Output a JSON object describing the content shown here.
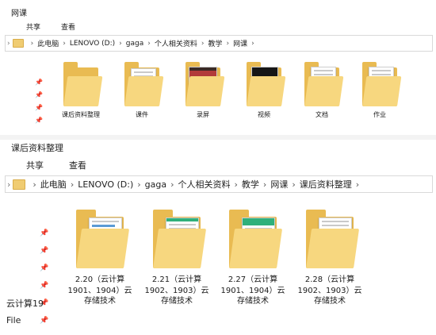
{
  "window1": {
    "title": "网课",
    "ribbon": [
      "共享",
      "查看"
    ],
    "breadcrumb": [
      "此电脑",
      "LENOVO (D:)",
      "gaga",
      "个人相关资料",
      "教学",
      "网课"
    ],
    "folders": [
      {
        "name": "课后资料整理",
        "preview": "plain"
      },
      {
        "name": "课件",
        "preview": "doc"
      },
      {
        "name": "录屏",
        "preview": "photo"
      },
      {
        "name": "视频",
        "preview": "video"
      },
      {
        "name": "文档",
        "preview": "doc"
      },
      {
        "name": "作业",
        "preview": "doc"
      }
    ]
  },
  "window2": {
    "title": "课后资料整理",
    "ribbon": [
      "共享",
      "查看"
    ],
    "breadcrumb": [
      "此电脑",
      "LENOVO (D:)",
      "gaga",
      "个人相关资料",
      "教学",
      "网课",
      "课后资料整理"
    ],
    "folders": [
      {
        "lines": [
          "2.20（云计算",
          "1901、1904）云",
          "存储技术"
        ]
      },
      {
        "lines": [
          "2.21（云计算",
          "1902、1903）云",
          "存储技术"
        ]
      },
      {
        "lines": [
          "2.27（云计算",
          "1901、1904）云",
          "存储技术"
        ]
      },
      {
        "lines": [
          "2.28（云计算",
          "1902、1903）云",
          "存储技术"
        ]
      }
    ],
    "nav_fragments": [
      "云计算19",
      "File"
    ]
  },
  "colors": {
    "folder_back": "#e9bb52",
    "folder_front": "#f7d77f",
    "accent_green": "#2fb07a"
  },
  "icons": [
    "pin-icon",
    "folder-icon",
    "chevron-right-icon"
  ]
}
